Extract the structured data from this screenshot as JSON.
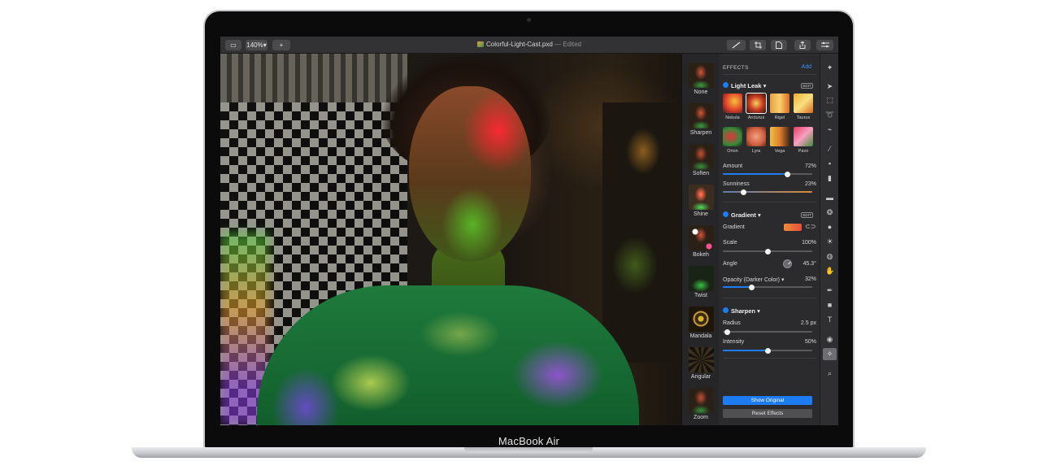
{
  "device": {
    "label": "MacBook Air"
  },
  "toolbar": {
    "zoom": "140%",
    "add_symbol": "+",
    "sidebar_symbol": "▭",
    "document_title": "Colorful-Light-Cast.pxd",
    "edited_suffix": "— Edited",
    "icons": [
      "brush-icon",
      "crop-icon",
      "document-icon",
      "share-icon",
      "adjust-icon"
    ]
  },
  "effect_strip": {
    "items": [
      {
        "label": "None"
      },
      {
        "label": "Sharpen"
      },
      {
        "label": "Soften"
      },
      {
        "label": "Shine"
      },
      {
        "label": "Bokeh"
      },
      {
        "label": "Twist"
      },
      {
        "label": "Mandala"
      },
      {
        "label": "Angular"
      },
      {
        "label": "Zoom"
      }
    ]
  },
  "panel": {
    "header": "EFFECTS",
    "add_label": "Add",
    "light_leak": {
      "title": "Light Leak",
      "edit_label": "EDIT",
      "presets": [
        {
          "label": "Nebula",
          "selected": false
        },
        {
          "label": "Arcturus",
          "selected": true
        },
        {
          "label": "Rigel",
          "selected": false
        },
        {
          "label": "Taurus",
          "selected": false
        },
        {
          "label": "Orion",
          "selected": false
        },
        {
          "label": "Lyra",
          "selected": false
        },
        {
          "label": "Vega",
          "selected": false
        },
        {
          "label": "Pavo",
          "selected": false
        }
      ],
      "amount": {
        "label": "Amount",
        "value": "72%",
        "level": 0.72
      },
      "sunniness": {
        "label": "Sunniness",
        "value": "23%",
        "level": 0.23
      }
    },
    "gradient": {
      "title": "Gradient",
      "edit_label": "EDIT",
      "gradient_label": "Gradient",
      "scale": {
        "label": "Scale",
        "value": "100%",
        "level": 0.5
      },
      "angle": {
        "label": "Angle",
        "value": "45.3°"
      },
      "opacity": {
        "label": "Opacity (Darker Color)",
        "value": "32%",
        "level": 0.32
      }
    },
    "sharpen": {
      "title": "Sharpen",
      "radius": {
        "label": "Radius",
        "value": "2.5 px",
        "level": 0.05
      },
      "intensity": {
        "label": "Intensity",
        "value": "50%",
        "level": 0.5
      }
    },
    "show_original": "Show Original",
    "reset_effects": "Reset Effects"
  },
  "colors": {
    "accent": "#1e7cf2",
    "panel_bg": "#2b2b2d",
    "sunniness_track": "#d88b3a"
  }
}
